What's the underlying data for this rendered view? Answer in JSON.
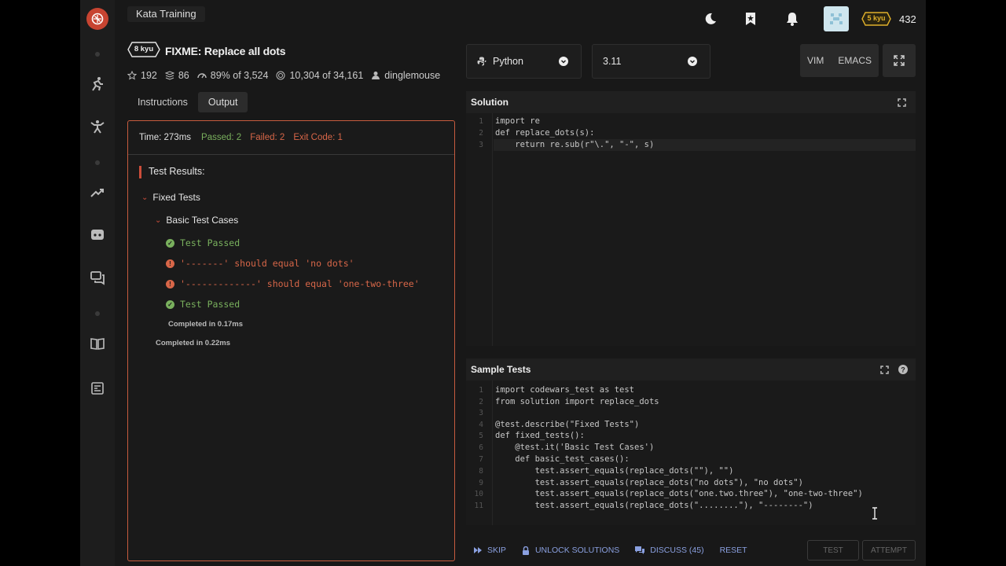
{
  "header": {
    "title": "Kata Training",
    "honor": "432",
    "rank_badge": "5 kyu"
  },
  "kata": {
    "rank": "8 kyu",
    "name": "FIXME: Replace all dots",
    "stars": "192",
    "collections": "86",
    "satisfaction": "89% of 3,524",
    "completed": "10,304 of 34,161",
    "author": "dinglemouse"
  },
  "tabs": [
    {
      "label": "Instructions",
      "active": false
    },
    {
      "label": "Output",
      "active": true
    }
  ],
  "output": {
    "time": "Time: 273ms",
    "passed": "Passed: 2",
    "failed": "Failed: 2",
    "exit_code": "Exit Code: 1",
    "results_title": "Test Results:",
    "group": "Fixed Tests",
    "subgroup": "Basic Test Cases",
    "lines": [
      {
        "status": "pass",
        "text": "Test Passed"
      },
      {
        "status": "fail",
        "text": "'-------' should equal 'no dots'"
      },
      {
        "status": "fail",
        "text": "'-------------' should equal 'one-two-three'"
      },
      {
        "status": "pass",
        "text": "Test Passed"
      }
    ],
    "sub_completed": "Completed in 0.17ms",
    "group_completed": "Completed in 0.22ms"
  },
  "editor_toolbar": {
    "language": "Python",
    "version": "3.11",
    "vim": "VIM",
    "emacs": "EMACS"
  },
  "solution": {
    "title": "Solution",
    "lines": [
      "import re",
      "def replace_dots(s):",
      "    return re.sub(r\"\\.\", \"-\", s)"
    ]
  },
  "sample_tests": {
    "title": "Sample Tests",
    "lines": [
      "import codewars_test as test",
      "from solution import replace_dots",
      "",
      "@test.describe(\"Fixed Tests\")",
      "def fixed_tests():",
      "    @test.it('Basic Test Cases')",
      "    def basic_test_cases():",
      "        test.assert_equals(replace_dots(\"\"), \"\")",
      "        test.assert_equals(replace_dots(\"no dots\"), \"no dots\")",
      "        test.assert_equals(replace_dots(\"one.two.three\"), \"one-two-three\")",
      "        test.assert_equals(replace_dots(\"........\"), \"--------\")"
    ]
  },
  "bottom_bar": {
    "skip": "SKIP",
    "unlock": "UNLOCK SOLUTIONS",
    "discuss": "DISCUSS (45)",
    "reset": "RESET",
    "test": "TEST",
    "attempt": "ATTEMPT"
  },
  "colors": {
    "accent": "#c74431",
    "pass": "#79b05d",
    "fail": "#d76648",
    "link": "#8aa0e0"
  }
}
